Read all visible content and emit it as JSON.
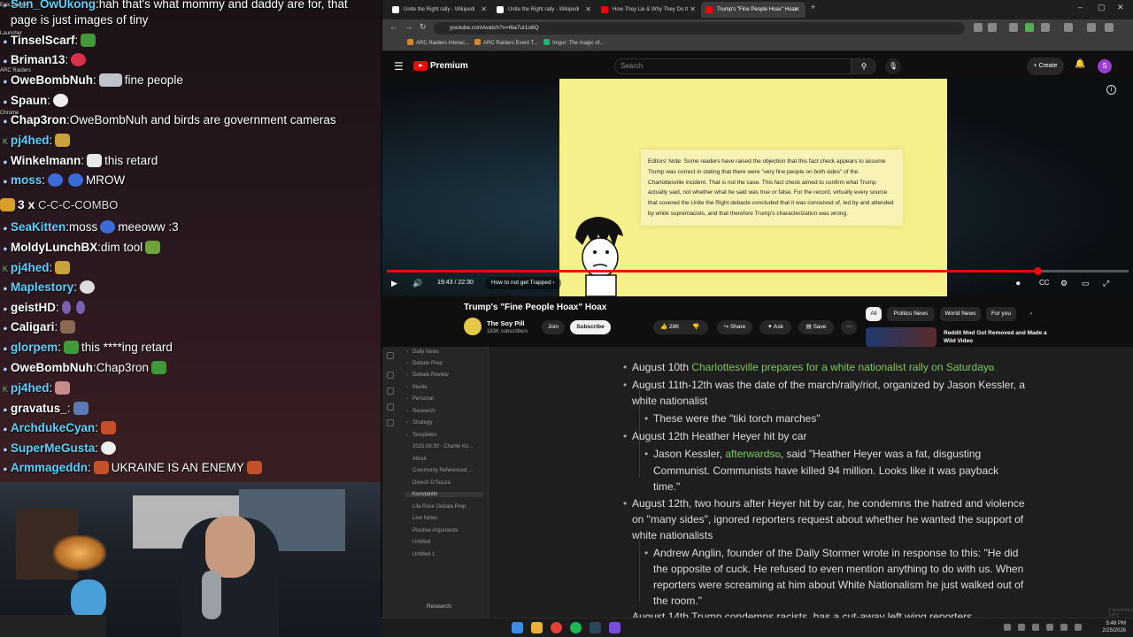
{
  "chat": {
    "top_partial": {
      "user": "Sun_OwUkong",
      "msg": "hah that's what mommy and daddy are for, that",
      "cont": "page is just images of tiny"
    },
    "lines": [
      {
        "user": "TinselScarf",
        "color": "#5ad1ff",
        "msg": ""
      },
      {
        "user": "Briman13",
        "color": "#ffffff",
        "msg": ""
      },
      {
        "user": "OweBombNuh",
        "color": "#ffffff",
        "msg": "fine people"
      },
      {
        "user": "Spaun",
        "color": "#ffffff",
        "msg": ""
      },
      {
        "user": "Chap3ron",
        "color": "#ffffff",
        "msg": "OweBombNuh and birds are government cameras"
      },
      {
        "user": "pj4hed",
        "color": "#5ad1ff",
        "msg": ""
      },
      {
        "user": "Winkelmann",
        "color": "#ffffff",
        "msg": "this retard"
      },
      {
        "user": "moss",
        "color": "#5ad1ff",
        "msg": "MROW"
      },
      {
        "user": "SeaKitten",
        "color": "#5ad1ff",
        "msg": "moss",
        "msg2": "meeoww :3"
      },
      {
        "user": "MoldyLunchBX",
        "color": "#ffffff",
        "msg": "dim tool"
      },
      {
        "user": "pj4hed",
        "color": "#5ad1ff",
        "msg": ""
      },
      {
        "user": "Maplestory",
        "color": "#5ad1ff",
        "msg": ""
      },
      {
        "user": "geistHD",
        "color": "#ffffff",
        "msg": ""
      },
      {
        "user": "Caligari",
        "color": "#ffffff",
        "msg": ""
      },
      {
        "user": "glorpem",
        "color": "#5ad1ff",
        "msg": "this ****ing retard"
      },
      {
        "user": "OweBombNuh",
        "color": "#ffffff",
        "msg": "Chap3ron"
      },
      {
        "user": "pj4hed",
        "color": "#5ad1ff",
        "msg": ""
      },
      {
        "user": "gravatus_",
        "color": "#ffffff",
        "msg": ""
      },
      {
        "user": "ArchdukeCyan",
        "color": "#5ad1ff",
        "msg": ""
      },
      {
        "user": "SuperMeGusta",
        "color": "#5ad1ff",
        "msg": ""
      },
      {
        "user": "Armmageddn",
        "color": "#5ad1ff",
        "msg": "UKRAINE IS AN ENEMY"
      }
    ],
    "combo": {
      "count": "3 x",
      "text": "C-C-C-COMBO"
    },
    "side_labels": [
      "Epic Games",
      "Launcher",
      "ARC Raiders",
      "Chrome"
    ]
  },
  "browser": {
    "tabs": [
      {
        "label": "Unite the Right rally - Wikipedi",
        "favicon": "#ffffff"
      },
      {
        "label": "Unite the Right rally - Wikipedi",
        "favicon": "#ffffff"
      },
      {
        "label": "How They Lie & Why They Do It",
        "favicon": "#ff0000"
      },
      {
        "label": "Trump's \"Fine People Hoax\" Hoax",
        "favicon": "#ff0000"
      }
    ],
    "url": "youtube.com/watch?v=t6a7uI1o8Q",
    "bookmarks": [
      "ARC Raiders Interac...",
      "ARC Raiders Event T...",
      "Imgur: The magic of..."
    ]
  },
  "youtube": {
    "brand": "Premium",
    "search_placeholder": "Search",
    "create_label": "Create",
    "avatar_letter": "S",
    "note_text": "Editors' Note: Some readers have raised the objection that this fact check appears to assume Trump was correct in stating that there were \"very fine people on both sides\" of the Charlottesville incident. That is not the case. This fact check aimed to confirm what Trump actually said, not whether what he said was true or false. For the record, virtually every source that covered the Unite the Right debacle concluded that it was conceived of, led by and attended by white supremacists, and that therefore Trump's characterization was wrong.",
    "timecode": "19:43 / 22:30",
    "chapter": "How to not get Trapped",
    "progress": 0.877,
    "video_title": "Trump's \"Fine People Hoax\" Hoax",
    "channel": "The Soy Pill",
    "subscribers": "183K subscribers",
    "join": "Join",
    "subscribe": "Subscribe",
    "likes": "28K",
    "share": "Share",
    "ask": "Ask",
    "save": "Save",
    "chips": [
      "All",
      "Politics News",
      "World News",
      "For you"
    ],
    "rec_title": "Reddit Mod Got Removed and Made a Wild Video"
  },
  "notes": {
    "folders": [
      "Daily News",
      "Debate Prep",
      "Debate Review",
      "Media",
      "Personal",
      "Research",
      "Strategy",
      "Templates"
    ],
    "files": [
      "2025.09.30 - Charlie Kir...",
      "About",
      "Commonly Referenced ...",
      "Dinesh D'Souza",
      "Konstantin",
      "Lila Rose Debate Prep",
      "Live Notes",
      "Positive Arguments",
      "Untitled",
      "Untitled 1"
    ],
    "selected_file": "Konstantin",
    "vault": "Research",
    "bullets": {
      "b1_pre": "August 10th ",
      "b1_link": "Charlottesville prepares for a white nationalist rally on Saturday",
      "b2": "August 11th-12th was the date of the march/rally/riot, organized by Jason Kessler, a white nationalist",
      "b2a": "These were the \"tiki torch marches\"",
      "b3": "August 12th Heather Heyer hit by car",
      "b3a_pre": "Jason Kessler, ",
      "b3a_link": "afterwards",
      "b3a_post": ", said \"Heather Heyer was a fat, disgusting Communist. Communists have killed 94 million. Looks like it was payback time.\"",
      "b4": "August 12th, two hours after Heyer hit by car, he condemns the hatred and violence on \"many sides\", ignored reporters request about whether he wanted the support of white nationalists",
      "b4a": "Andrew Anglin, founder of the Daily Stormer wrote in response to this: \"He did the opposite of cuck. He refused to even mention anything to do with us. When reporters were screaming at him about White Nationalism he just walked out of the room.\"",
      "b5_partial": "August 14th Trump condemns racists, has a cut-away left wing reporters"
    },
    "status": "0 backlinks   2471 words   15,411 characters"
  },
  "taskbar": {
    "time": "5:48 PM",
    "date": "2/25/2026"
  }
}
